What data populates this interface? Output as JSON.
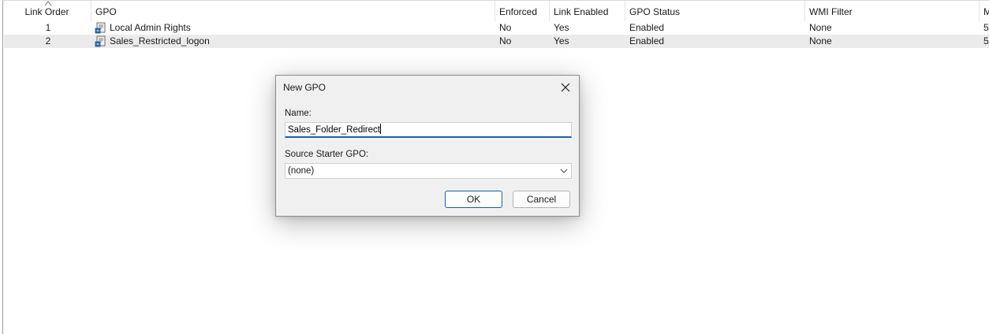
{
  "columns": [
    {
      "key": "link_order",
      "label": "Link Order"
    },
    {
      "key": "gpo",
      "label": "GPO"
    },
    {
      "key": "enforced",
      "label": "Enforced"
    },
    {
      "key": "link_enabled",
      "label": "Link Enabled"
    },
    {
      "key": "gpo_status",
      "label": "GPO Status"
    },
    {
      "key": "wmi_filter",
      "label": "WMI Filter"
    },
    {
      "key": "modified",
      "label": "M"
    }
  ],
  "rows": [
    {
      "link_order": "1",
      "gpo": "Local Admin Rights",
      "enforced": "No",
      "link_enabled": "Yes",
      "gpo_status": "Enabled",
      "wmi_filter": "None",
      "modified": "5/"
    },
    {
      "link_order": "2",
      "gpo": "Sales_Restricted_logon",
      "enforced": "No",
      "link_enabled": "Yes",
      "gpo_status": "Enabled",
      "wmi_filter": "None",
      "modified": "5/"
    }
  ],
  "icons": {
    "gpo": "gpo-scroll-icon",
    "sort": "sort-ascending-icon",
    "close": "close-icon",
    "dropdown": "chevron-down-icon"
  },
  "dialog": {
    "title": "New GPO",
    "name_label": "Name:",
    "name_value": "Sales_Folder_Redirect",
    "starter_label": "Source Starter GPO:",
    "starter_value": "(none)",
    "ok_label": "OK",
    "cancel_label": "Cancel"
  },
  "colors": {
    "accent": "#1c5fa8",
    "selected_row": "#ebebeb",
    "dialog_bg": "#f0f0f0"
  }
}
